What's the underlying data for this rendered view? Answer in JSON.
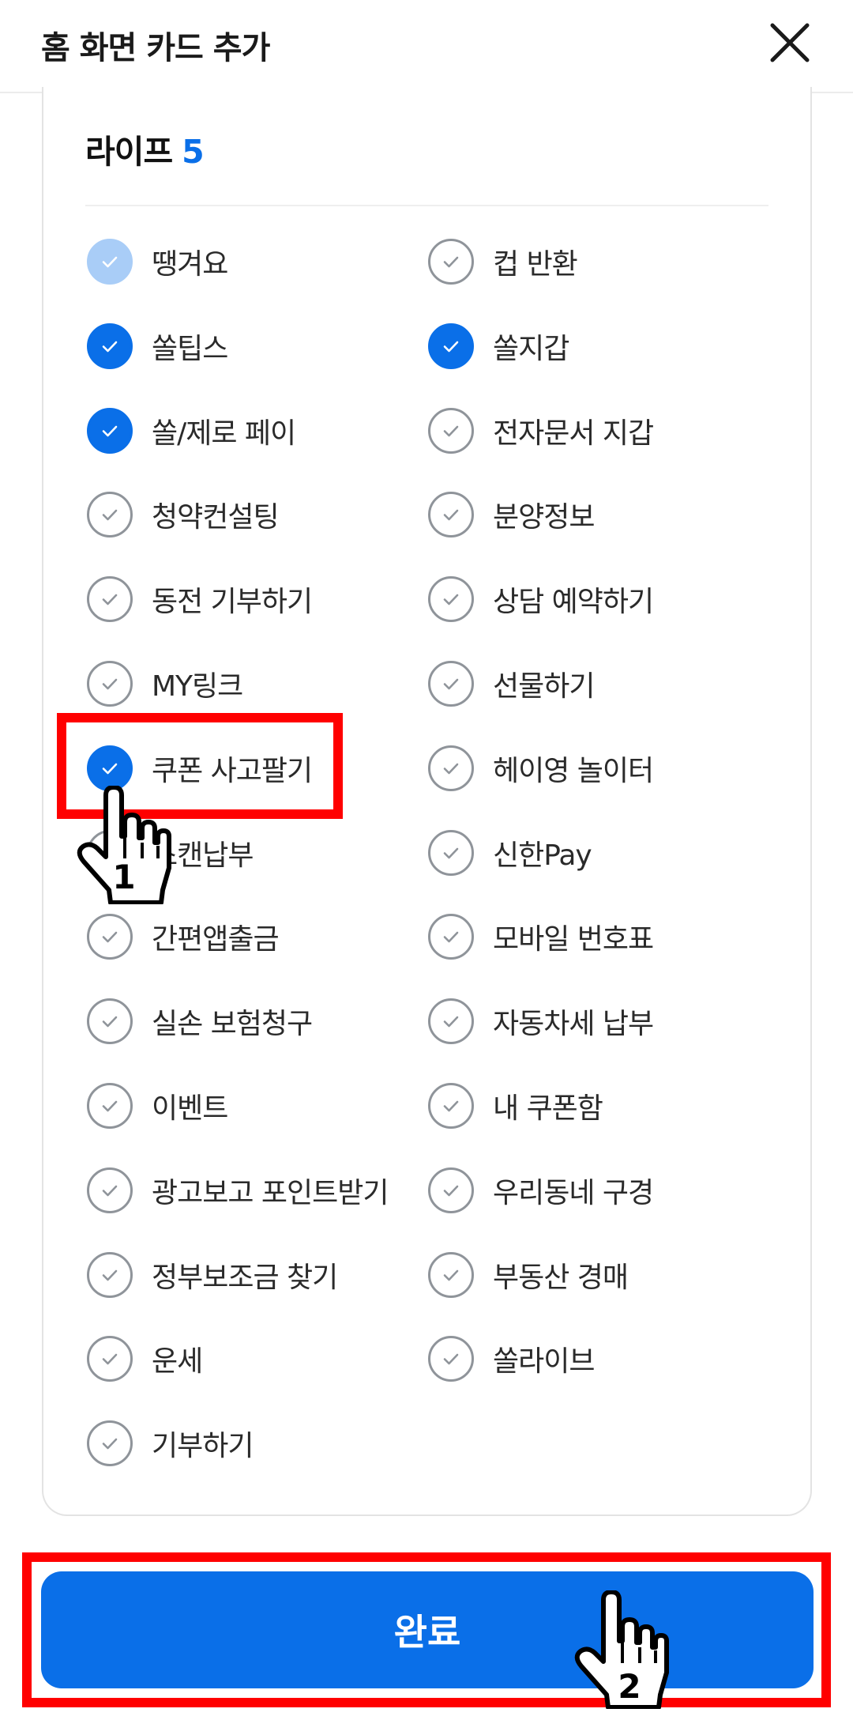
{
  "header": {
    "title": "홈 화면 카드 추가"
  },
  "section": {
    "title": "라이프",
    "count": "5"
  },
  "items": [
    {
      "label": "땡겨요",
      "state": "disabled"
    },
    {
      "label": "컵 반환",
      "state": "unchecked"
    },
    {
      "label": "쏠팁스",
      "state": "checked"
    },
    {
      "label": "쏠지갑",
      "state": "checked"
    },
    {
      "label": "쏠/제로 페이",
      "state": "checked"
    },
    {
      "label": "전자문서 지갑",
      "state": "unchecked"
    },
    {
      "label": "청약컨설팅",
      "state": "unchecked"
    },
    {
      "label": "분양정보",
      "state": "unchecked"
    },
    {
      "label": "동전 기부하기",
      "state": "unchecked"
    },
    {
      "label": "상담 예약하기",
      "state": "unchecked"
    },
    {
      "label": "MY링크",
      "state": "unchecked"
    },
    {
      "label": "선물하기",
      "state": "unchecked"
    },
    {
      "label": "쿠폰 사고팔기",
      "state": "checked"
    },
    {
      "label": "헤이영 놀이터",
      "state": "unchecked"
    },
    {
      "label": "스캔납부",
      "state": "unchecked"
    },
    {
      "label": "신한Pay",
      "state": "unchecked"
    },
    {
      "label": "간편앱출금",
      "state": "unchecked"
    },
    {
      "label": "모바일 번호표",
      "state": "unchecked"
    },
    {
      "label": "실손 보험청구",
      "state": "unchecked"
    },
    {
      "label": "자동차세 납부",
      "state": "unchecked"
    },
    {
      "label": "이벤트",
      "state": "unchecked"
    },
    {
      "label": "내 쿠폰함",
      "state": "unchecked"
    },
    {
      "label": "광고보고 포인트받기",
      "state": "unchecked"
    },
    {
      "label": "우리동네 구경",
      "state": "unchecked"
    },
    {
      "label": "정부보조금 찾기",
      "state": "unchecked"
    },
    {
      "label": "부동산 경매",
      "state": "unchecked"
    },
    {
      "label": "운세",
      "state": "unchecked"
    },
    {
      "label": "쏠라이브",
      "state": "unchecked"
    },
    {
      "label": "기부하기",
      "state": "unchecked"
    }
  ],
  "done_button": {
    "label": "완료"
  },
  "annotations": {
    "step1": "1",
    "step2": "2"
  },
  "colors": {
    "accent": "#0a6fe8",
    "highlight": "#ff0000",
    "disabled_check": "#a9cdf7"
  }
}
